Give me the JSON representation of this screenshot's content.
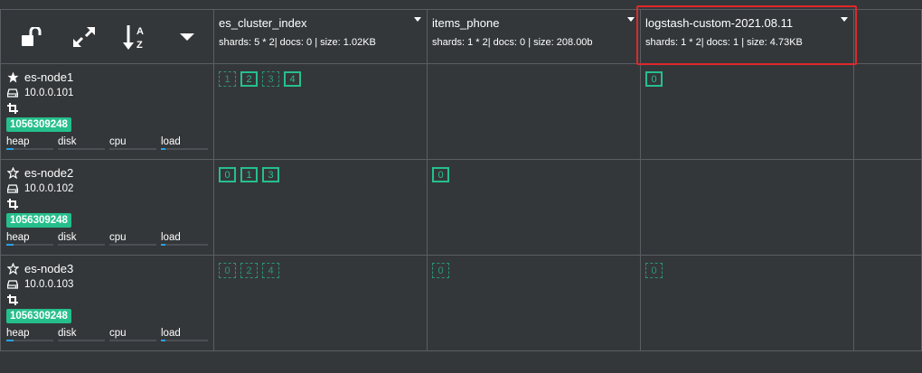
{
  "toolbar": {
    "icons": [
      "unlock-icon",
      "expand-icon",
      "sort-alpha-icon",
      "caret-down-icon"
    ],
    "sort_letters": [
      "A",
      "Z"
    ]
  },
  "indices": [
    {
      "name": "es_cluster_index",
      "stats": "shards: 5 * 2| docs: 0 | size: 1.02KB"
    },
    {
      "name": "items_phone",
      "stats": "shards: 1 * 2| docs: 0 | size: 208.00b"
    },
    {
      "name": "logstash-custom-2021.08.11",
      "stats": "shards: 1 * 2| docs: 1 | size: 4.73KB"
    }
  ],
  "metric_labels": {
    "heap": "heap",
    "disk": "disk",
    "cpu": "cpu",
    "load": "load"
  },
  "nodes": [
    {
      "name": "es-node1",
      "ip": "10.0.0.101",
      "id": "1056309248",
      "master": true,
      "metrics": {
        "heap": 0.15,
        "disk": 0.0,
        "cpu": 0.0,
        "load": 0.1
      },
      "shards": [
        [
          {
            "n": "1",
            "primary": false
          },
          {
            "n": "2",
            "primary": true
          },
          {
            "n": "3",
            "primary": false
          },
          {
            "n": "4",
            "primary": true
          }
        ],
        [],
        [
          {
            "n": "0",
            "primary": true
          }
        ]
      ]
    },
    {
      "name": "es-node2",
      "ip": "10.0.0.102",
      "id": "1056309248",
      "master": false,
      "metrics": {
        "heap": 0.15,
        "disk": 0.0,
        "cpu": 0.0,
        "load": 0.1
      },
      "shards": [
        [
          {
            "n": "0",
            "primary": true
          },
          {
            "n": "1",
            "primary": true
          },
          {
            "n": "3",
            "primary": true
          }
        ],
        [
          {
            "n": "0",
            "primary": true
          }
        ],
        []
      ]
    },
    {
      "name": "es-node3",
      "ip": "10.0.0.103",
      "id": "1056309248",
      "master": false,
      "metrics": {
        "heap": 0.15,
        "disk": 0.0,
        "cpu": 0.0,
        "load": 0.1
      },
      "shards": [
        [
          {
            "n": "0",
            "primary": false
          },
          {
            "n": "2",
            "primary": false
          },
          {
            "n": "4",
            "primary": false
          }
        ],
        [
          {
            "n": "0",
            "primary": false
          }
        ],
        [
          {
            "n": "0",
            "primary": false
          }
        ]
      ]
    }
  ],
  "colors": {
    "background": "#34373a",
    "accent": "#26bf8c",
    "highlight": "#e0282b",
    "bar": "#2ba1e0"
  }
}
